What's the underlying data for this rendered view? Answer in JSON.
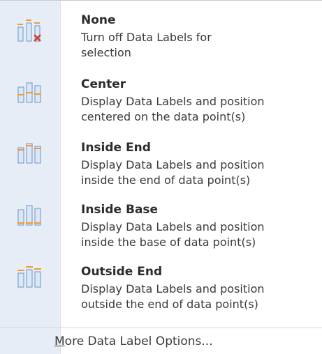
{
  "menu": {
    "items": [
      {
        "title": "None",
        "desc_lines": [
          "Turn off Data Labels for",
          "selection"
        ],
        "icon": "chart-labels-none-icon"
      },
      {
        "title": "Center",
        "desc_lines": [
          "Display Data Labels and position",
          "centered on the data point(s)"
        ],
        "icon": "chart-labels-center-icon"
      },
      {
        "title": "Inside End",
        "desc_lines": [
          "Display Data Labels and position",
          "inside the end of data point(s)"
        ],
        "icon": "chart-labels-inside-end-icon"
      },
      {
        "title": "Inside Base",
        "desc_lines": [
          "Display Data Labels and position",
          "inside the base of data point(s)"
        ],
        "icon": "chart-labels-inside-base-icon"
      },
      {
        "title": "Outside End",
        "desc_lines": [
          "Display Data Labels and position",
          "outside the end of data point(s)"
        ],
        "icon": "chart-labels-outside-end-icon"
      }
    ],
    "more_options": {
      "accel": "M",
      "rest": "ore Data Label Options..."
    },
    "colors": {
      "gutter": "#e7edf6",
      "bar_fill": "#d9e7f7",
      "bar_stroke": "#6f94c4",
      "label_orange": "#f39a2b",
      "x_red": "#d23a2a"
    }
  }
}
